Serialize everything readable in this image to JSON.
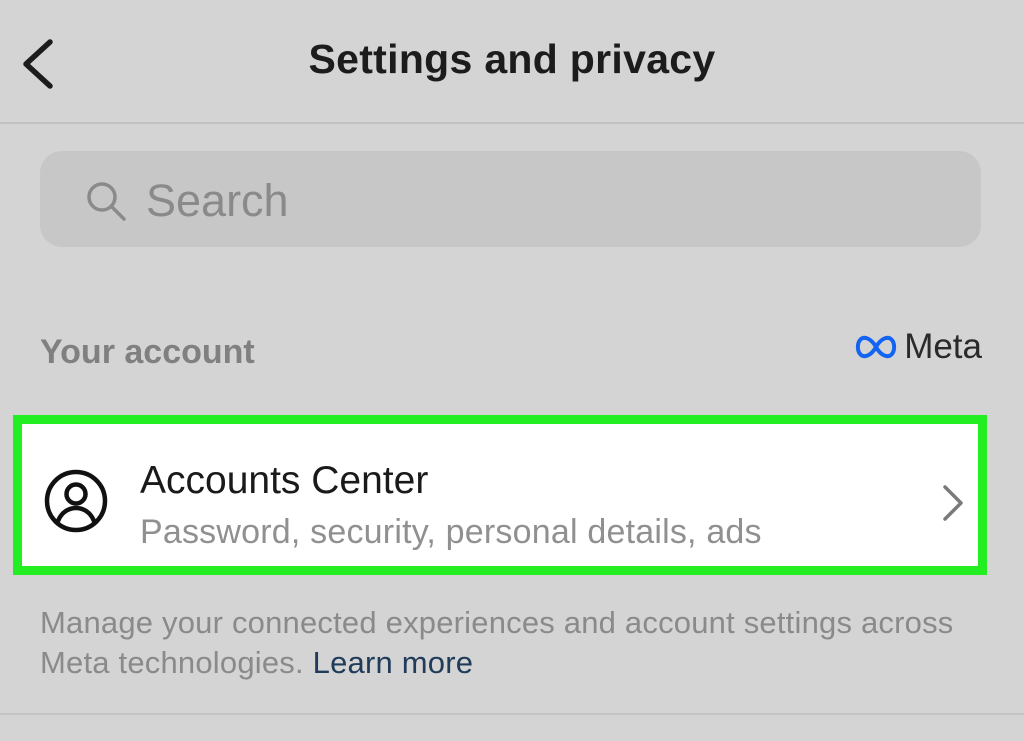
{
  "header": {
    "title": "Settings and privacy",
    "back_icon": "chevron-left-icon"
  },
  "search": {
    "placeholder": "Search",
    "icon": "search-icon"
  },
  "section": {
    "label": "Your account",
    "brand": "Meta",
    "brand_icon": "meta-infinity-logo",
    "brand_color": "#1464f4"
  },
  "accounts_center": {
    "title": "Accounts Center",
    "subtitle": "Password, security, personal details, ads",
    "icon": "person-circle-icon",
    "trailing_icon": "chevron-right-icon",
    "highlight_color": "#22ee22"
  },
  "footer": {
    "text": "Manage your connected experiences and account settings across Meta technologies.",
    "link": "Learn more",
    "link_color": "#213c5a"
  }
}
